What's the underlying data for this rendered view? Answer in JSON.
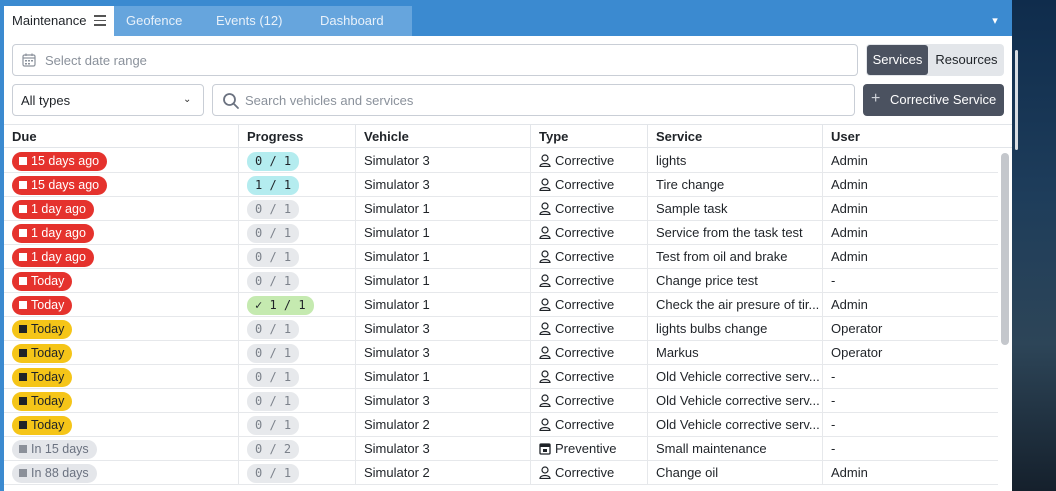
{
  "tabs": [
    {
      "label": "Maintenance",
      "active": true
    },
    {
      "label": "Geofence",
      "active": false
    },
    {
      "label": "Events (12)",
      "active": false
    },
    {
      "label": "Dashboard",
      "active": false
    }
  ],
  "filters": {
    "date_placeholder": "Select date range",
    "type_value": "All types",
    "search_placeholder": "Search vehicles and services",
    "segment_active": "Services",
    "segment_inactive": "Resources",
    "add_button": "Corrective Service"
  },
  "table": {
    "headers": [
      "Due",
      "Progress",
      "Vehicle",
      "Type",
      "Service",
      "User"
    ],
    "rows": [
      {
        "due": "15 days ago",
        "due_color": "red",
        "progress": "0 / 1",
        "progress_style": "cyan",
        "vehicle": "Simulator 3",
        "type": "Corrective",
        "type_icon": "person-icon",
        "service": "lights",
        "user": "Admin"
      },
      {
        "due": "15 days ago",
        "due_color": "red",
        "progress": "1 / 1",
        "progress_style": "cyan",
        "vehicle": "Simulator 3",
        "type": "Corrective",
        "type_icon": "person-icon",
        "service": "Tire change",
        "user": "Admin"
      },
      {
        "due": "1 day ago",
        "due_color": "red",
        "progress": "0 / 1",
        "progress_style": "gray",
        "vehicle": "Simulator 1",
        "type": "Corrective",
        "type_icon": "person-icon",
        "service": "Sample task",
        "user": "Admin"
      },
      {
        "due": "1 day ago",
        "due_color": "red",
        "progress": "0 / 1",
        "progress_style": "gray",
        "vehicle": "Simulator 1",
        "type": "Corrective",
        "type_icon": "person-icon",
        "service": "Service from the task test",
        "user": "Admin"
      },
      {
        "due": "1 day ago",
        "due_color": "red",
        "progress": "0 / 1",
        "progress_style": "gray",
        "vehicle": "Simulator 1",
        "type": "Corrective",
        "type_icon": "person-icon",
        "service": "Test from oil and brake",
        "user": "Admin"
      },
      {
        "due": "Today",
        "due_color": "red",
        "progress": "0 / 1",
        "progress_style": "gray",
        "vehicle": "Simulator 1",
        "type": "Corrective",
        "type_icon": "person-icon",
        "service": "Change price test",
        "user": "-"
      },
      {
        "due": "Today",
        "due_color": "red",
        "progress": "✓ 1 / 1",
        "progress_style": "green",
        "vehicle": "Simulator 1",
        "type": "Corrective",
        "type_icon": "person-icon",
        "service": "Check the air presure of tir...",
        "user": "Admin"
      },
      {
        "due": "Today",
        "due_color": "yellow",
        "progress": "0 / 1",
        "progress_style": "gray",
        "vehicle": "Simulator 3",
        "type": "Corrective",
        "type_icon": "person-icon",
        "service": "lights bulbs change",
        "user": "Operator"
      },
      {
        "due": "Today",
        "due_color": "yellow",
        "progress": "0 / 1",
        "progress_style": "gray",
        "vehicle": "Simulator 3",
        "type": "Corrective",
        "type_icon": "person-icon",
        "service": "Markus",
        "user": "Operator"
      },
      {
        "due": "Today",
        "due_color": "yellow",
        "progress": "0 / 1",
        "progress_style": "gray",
        "vehicle": "Simulator 1",
        "type": "Corrective",
        "type_icon": "person-icon",
        "service": "Old Vehicle corrective serv...",
        "user": "-"
      },
      {
        "due": "Today",
        "due_color": "yellow",
        "progress": "0 / 1",
        "progress_style": "gray",
        "vehicle": "Simulator 3",
        "type": "Corrective",
        "type_icon": "person-icon",
        "service": "Old Vehicle corrective serv...",
        "user": "-"
      },
      {
        "due": "Today",
        "due_color": "yellow",
        "progress": "0 / 1",
        "progress_style": "gray",
        "vehicle": "Simulator 2",
        "type": "Corrective",
        "type_icon": "person-icon",
        "service": "Old Vehicle corrective serv...",
        "user": "-"
      },
      {
        "due": "In 15 days",
        "due_color": "gray",
        "progress": "0 / 2",
        "progress_style": "gray",
        "vehicle": "Simulator 3",
        "type": "Preventive",
        "type_icon": "calendar-icon",
        "service": "Small maintenance",
        "user": "-"
      },
      {
        "due": "In 88 days",
        "due_color": "gray",
        "progress": "0 / 1",
        "progress_style": "gray",
        "vehicle": "Simulator 2",
        "type": "Corrective",
        "type_icon": "person-icon",
        "service": "Change oil",
        "user": "Admin"
      }
    ]
  },
  "colors": {
    "tabbar": "#3b8ad0",
    "overdue": "#e5322d",
    "due_today": "#f5c518",
    "upcoming": "#e4e6ea",
    "progress_active": "#b4ecef",
    "progress_done": "#c5eab0",
    "primary_button": "#4b5260"
  }
}
